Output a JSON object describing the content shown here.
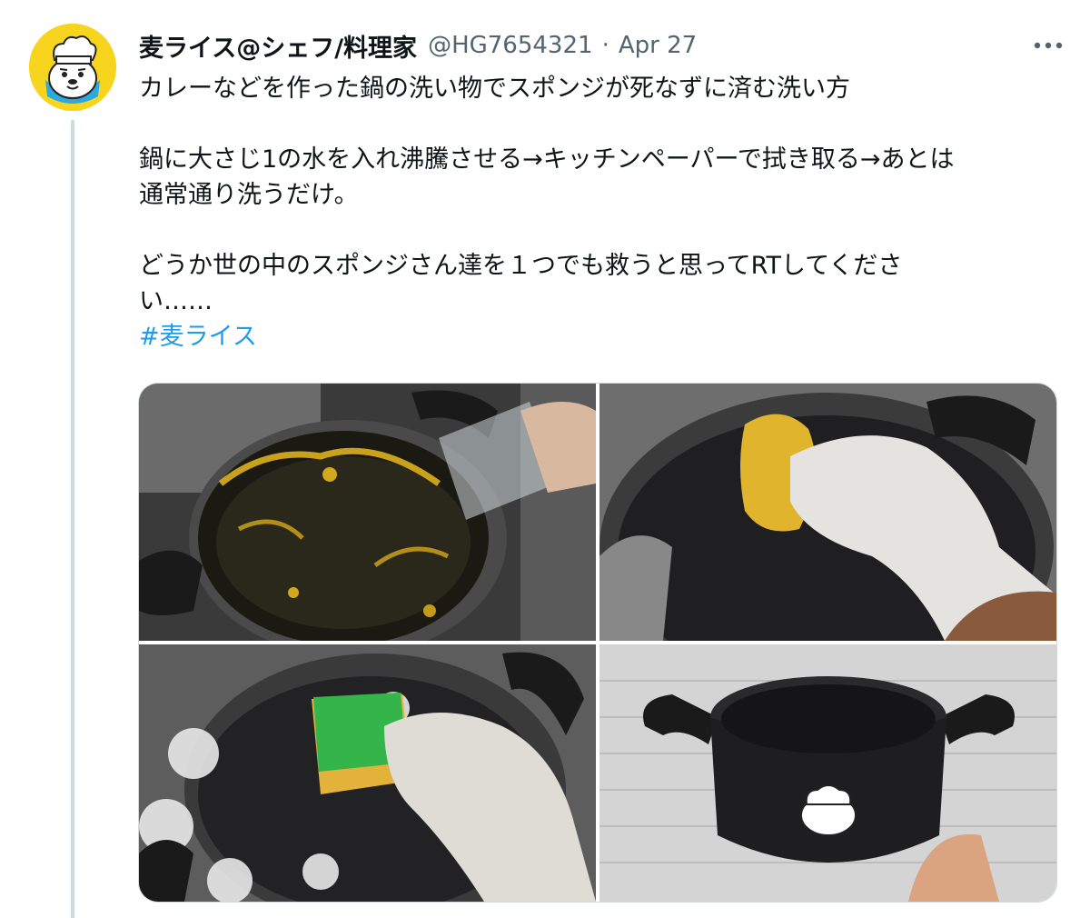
{
  "tweet": {
    "display_name": "麦ライス@シェフ/料理家",
    "handle": "@HG7654321",
    "separator": "·",
    "date": "Apr 27",
    "text_lines": [
      "カレーなどを作った鍋の洗い物でスポンジが死なずに済む洗い方",
      "鍋に大さじ1の水を入れ沸騰させる→キッチンペーパーで拭き取る→あとは",
      "通常通り洗うだけ。",
      "どうか世の中のスポンジさん達を１つでも救うと思ってRTしてくださ",
      "い……"
    ],
    "hashtag": "#麦ライス"
  },
  "colors": {
    "text": "#0f1419",
    "secondary": "#536471",
    "link": "#1d9bf0",
    "thread_line": "#cfd9de",
    "avatar_bg": "#f7d51e"
  },
  "icons": {
    "more": "more-horizontal-icon",
    "avatar": "chef-rice-character-avatar"
  }
}
